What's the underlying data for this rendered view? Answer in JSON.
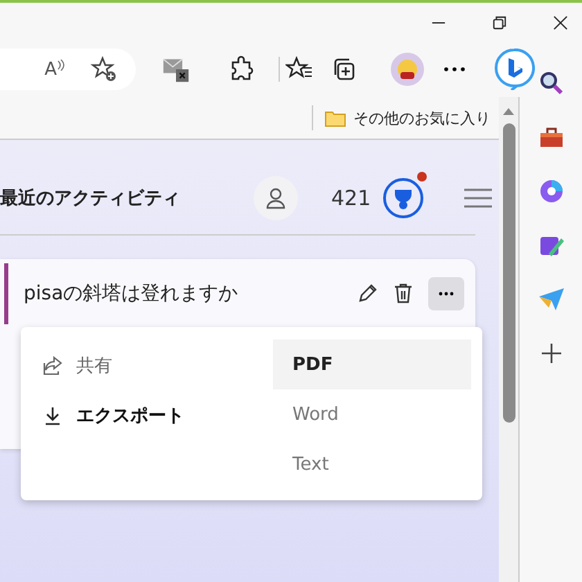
{
  "toolbar": {
    "read_aloud": "A"
  },
  "bookmarks_bar": {
    "folder": "その他のお気に入り"
  },
  "panel": {
    "title": "最近のアクティビティ",
    "points": "421",
    "notification": true
  },
  "card": {
    "title": "pisaの斜塔は登れますか"
  },
  "menu": {
    "items": [
      {
        "kind": "share",
        "label": "共有",
        "selected": false
      },
      {
        "kind": "export",
        "label": "エクスポート",
        "selected": true
      }
    ],
    "submenu": [
      {
        "label": "PDF",
        "selected": true
      },
      {
        "label": "Word",
        "selected": false
      },
      {
        "label": "Text",
        "selected": false
      }
    ]
  }
}
